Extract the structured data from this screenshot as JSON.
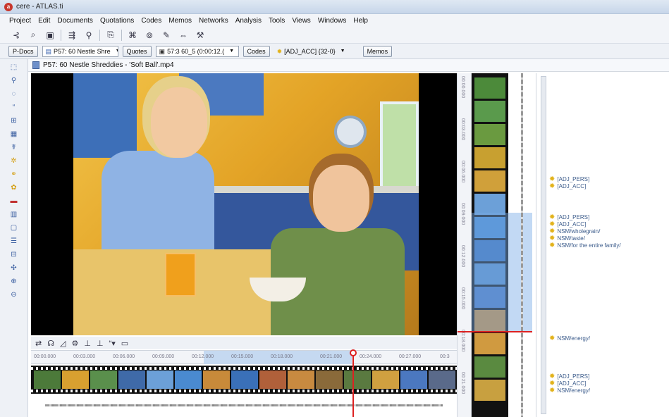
{
  "window": {
    "title": "cere - ATLAS.ti",
    "app_icon": "a"
  },
  "menu": [
    "Project",
    "Edit",
    "Documents",
    "Quotations",
    "Codes",
    "Memos",
    "Networks",
    "Analysis",
    "Tools",
    "Views",
    "Windows",
    "Help"
  ],
  "docbar": {
    "pdocs_label": "P-Docs",
    "pdoc_value": "P57: 60 Nestle Shre",
    "quotes_label": "Quotes",
    "quote_value": "57:3 60_5 (0:00:12.(",
    "codes_label": "Codes",
    "code_value": "[ADJ_ACC] {32-0}",
    "memos_label": "Memos"
  },
  "document": {
    "title": "P57: 60 Nestle Shreddies - 'Soft Ball'.mp4"
  },
  "timeline": {
    "ticks": [
      "00:00.000",
      "00:03.000",
      "00:06.000",
      "00:09.000",
      "00:12.000",
      "00:15.000",
      "00:18.000",
      "00:21.000",
      "00:24.000",
      "00:27.000",
      "00:3"
    ]
  },
  "margin_codes": {
    "group1": [
      "[ADJ_PERS]",
      "[ADJ_ACC]"
    ],
    "group2": [
      "[ADJ_PERS]",
      "[ADJ_ACC]",
      "NSM/wholegrain/",
      "NSM/taste/",
      "NSM/for the entire family/"
    ],
    "group3": [
      "NSM/energy/"
    ],
    "group4": [
      "[ADJ_PERS]",
      "[ADJ_ACC]",
      "NSM/energy/"
    ]
  },
  "colors": {
    "selection": "#c5d9f1",
    "playhead": "#dd2222",
    "code_text": "#3a5a8a",
    "code_icon": "#e2b21a"
  }
}
